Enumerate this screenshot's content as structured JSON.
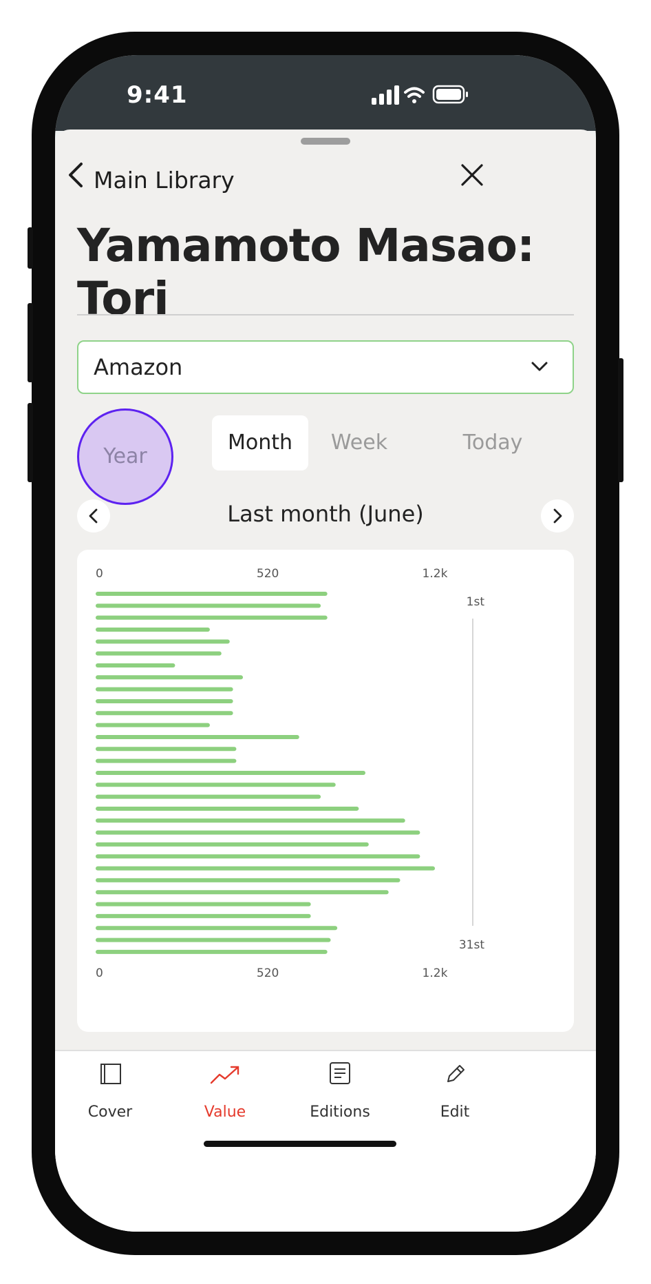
{
  "status_bar": {
    "time": "9:41"
  },
  "header": {
    "back_label": "Main Library",
    "title": "Yamamoto Masao: Tori"
  },
  "store_dropdown": {
    "selected": "Amazon"
  },
  "segments": [
    "Year",
    "Month",
    "Week",
    "Today"
  ],
  "selected_segment": "Month",
  "period_label": "Last month (June)",
  "colors": {
    "bar": "#8dd07f",
    "accent_red": "#e53a2c",
    "year_highlight": "#d9c8f2",
    "year_ring": "#5d22f0"
  },
  "chart_data": {
    "type": "bar",
    "orientation": "horizontal",
    "x_ticks": [
      "0",
      "520",
      "1.2k"
    ],
    "xlim": [
      0,
      1200
    ],
    "y_start_label": "1st",
    "y_end_label": "31st",
    "categories": [
      "1",
      "2",
      "3",
      "4",
      "5",
      "6",
      "7",
      "8",
      "9",
      "10",
      "11",
      "12",
      "13",
      "14",
      "15",
      "16",
      "17",
      "18",
      "19",
      "20",
      "21",
      "22",
      "23",
      "24",
      "25",
      "26",
      "27",
      "28",
      "29",
      "30",
      "31"
    ],
    "values": [
      700,
      680,
      700,
      345,
      405,
      380,
      240,
      445,
      415,
      415,
      415,
      345,
      615,
      425,
      425,
      815,
      725,
      680,
      795,
      935,
      980,
      825,
      980,
      1025,
      920,
      885,
      650,
      650,
      730,
      710,
      700
    ]
  },
  "tabbar": {
    "items": [
      {
        "label": "Cover",
        "icon": "cover-icon"
      },
      {
        "label": "Value",
        "icon": "trend-icon",
        "active": true
      },
      {
        "label": "Editions",
        "icon": "editions-icon"
      },
      {
        "label": "Edit",
        "icon": "pencil-icon"
      }
    ]
  }
}
